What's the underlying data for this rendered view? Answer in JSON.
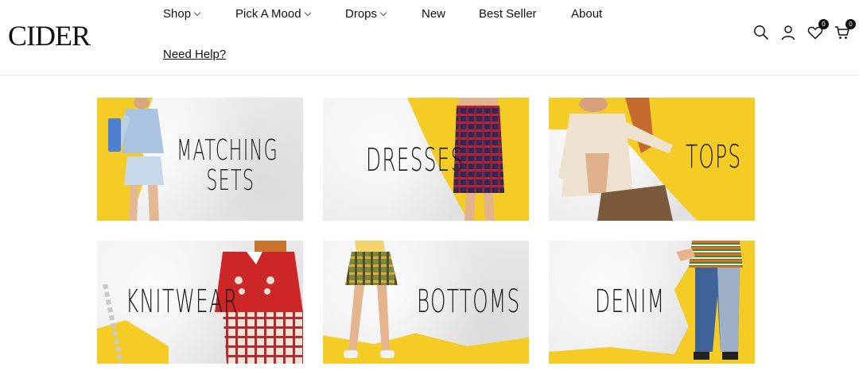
{
  "brand": {
    "logo": "CIDER"
  },
  "nav": {
    "items": [
      {
        "label": "Shop",
        "has_dropdown": true
      },
      {
        "label": "Pick A Mood",
        "has_dropdown": true
      },
      {
        "label": "Drops",
        "has_dropdown": true
      },
      {
        "label": "New",
        "has_dropdown": false
      },
      {
        "label": "Best Seller",
        "has_dropdown": false
      },
      {
        "label": "About",
        "has_dropdown": false
      }
    ],
    "help": "Need Help?"
  },
  "header_icons": {
    "search": "search-icon",
    "account": "user-icon",
    "wishlist": {
      "icon": "heart-icon",
      "count": "0"
    },
    "cart": {
      "icon": "cart-icon",
      "count": "0"
    }
  },
  "colors": {
    "accent_yellow": "#f5cc26",
    "text": "#111111"
  },
  "categories": [
    {
      "label_line1": "Matching",
      "label_line2": "Sets"
    },
    {
      "label_line1": "Dresses"
    },
    {
      "label_line1": "Tops"
    },
    {
      "label_line1": "Knitwear"
    },
    {
      "label_line1": "Bottoms"
    },
    {
      "label_line1": "Denim"
    }
  ]
}
